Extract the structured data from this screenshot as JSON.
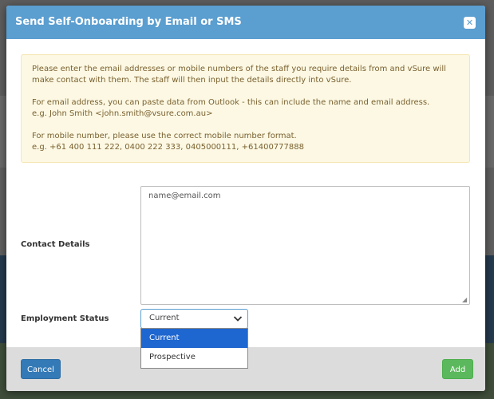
{
  "modal": {
    "title": "Send Self-Onboarding by Email or SMS",
    "close_icon": "close-icon"
  },
  "alert": {
    "line1": "Please enter the email addresses or mobile numbers of the staff you require details from and vSure will make contact with them. The staff will then input the details directly into vSure.",
    "line2": "For email address, you can paste data from Outlook - this can include the name and email address.",
    "line3": "e.g. John Smith <john.smith@vsure.com.au>",
    "line4": "For mobile number, please use the correct mobile number format.",
    "line5": "e.g. +61 400 111 222, 0400 222 333, 0405000111, +61400777888"
  },
  "form": {
    "contact_label": "Contact Details",
    "contact_placeholder": "name@email.com",
    "employment_label": "Employment Status",
    "employment_value": "Current",
    "employment_options": [
      "Current",
      "Prospective"
    ]
  },
  "footer": {
    "cancel_label": "Cancel",
    "add_label": "Add"
  },
  "colors": {
    "header": "#5b9ed0",
    "alert_bg": "#fcf8e3",
    "cancel": "#337ab7",
    "add": "#5cb85c",
    "selected_option": "#1e66d0"
  }
}
